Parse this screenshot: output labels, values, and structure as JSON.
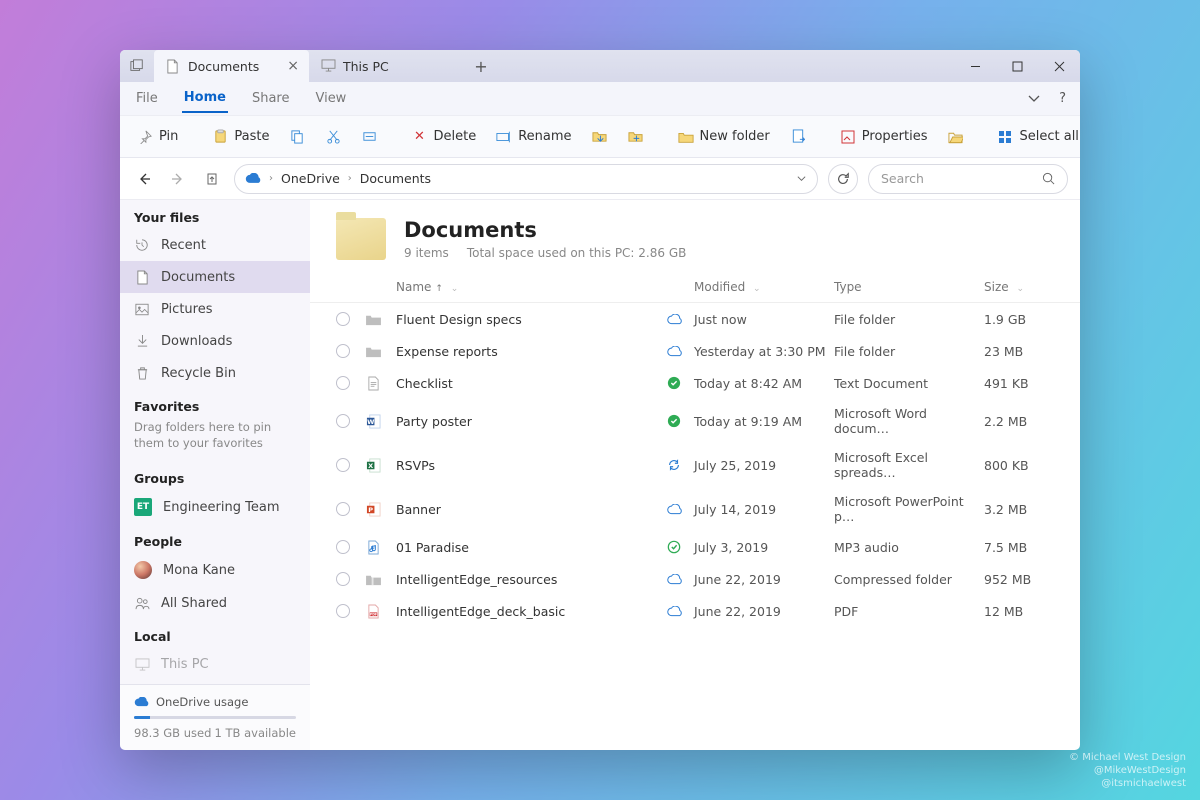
{
  "tabs": [
    {
      "label": "Documents",
      "icon": "document-icon",
      "active": true,
      "closable": true
    },
    {
      "label": "This PC",
      "icon": "pc-icon",
      "active": false,
      "closable": false
    }
  ],
  "menu": {
    "items": [
      "File",
      "Home",
      "Share",
      "View"
    ],
    "active": "Home"
  },
  "ribbon": {
    "pin": "Pin",
    "paste": "Paste",
    "delete": "Delete",
    "rename": "Rename",
    "newfolder": "New folder",
    "properties": "Properties",
    "selectall": "Select all"
  },
  "breadcrumb": [
    "OneDrive",
    "Documents"
  ],
  "search": {
    "placeholder": "Search"
  },
  "sidebar": {
    "sections": [
      {
        "title": "Your files",
        "items": [
          {
            "label": "Recent",
            "icon": "recent-icon"
          },
          {
            "label": "Documents",
            "icon": "document-icon",
            "selected": true
          },
          {
            "label": "Pictures",
            "icon": "pictures-icon"
          },
          {
            "label": "Downloads",
            "icon": "downloads-icon"
          },
          {
            "label": "Recycle Bin",
            "icon": "recycle-icon"
          }
        ]
      },
      {
        "title": "Favorites",
        "hint": "Drag folders here to pin them to your favorites"
      },
      {
        "title": "Groups",
        "items": [
          {
            "label": "Engineering Team",
            "icon": "et-chip",
            "chip": "ET"
          }
        ]
      },
      {
        "title": "People",
        "items": [
          {
            "label": "Mona Kane",
            "icon": "avatar"
          },
          {
            "label": "All Shared",
            "icon": "people-icon"
          }
        ]
      },
      {
        "title": "Local",
        "items": [
          {
            "label": "This PC",
            "icon": "pc-icon",
            "faded": true
          }
        ]
      }
    ],
    "storage": {
      "title": "OneDrive usage",
      "used": "98.3 GB used",
      "avail": "1 TB available"
    }
  },
  "header": {
    "title": "Documents",
    "count": "9 items",
    "space": "Total space used on this PC: 2.86 GB"
  },
  "columns": {
    "name": "Name",
    "modified": "Modified",
    "type": "Type",
    "size": "Size"
  },
  "files": [
    {
      "name": "Fluent Design specs",
      "icon": "folder-item",
      "status": "cloud",
      "modified": "Just now",
      "type": "File folder",
      "size": "1.9 GB"
    },
    {
      "name": "Expense reports",
      "icon": "folder-item",
      "status": "cloud",
      "modified": "Yesterday at 3:30 PM",
      "type": "File folder",
      "size": "23 MB"
    },
    {
      "name": "Checklist",
      "icon": "txt",
      "status": "synced",
      "modified": "Today at 8:42 AM",
      "type": "Text Document",
      "size": "491 KB"
    },
    {
      "name": "Party poster",
      "icon": "word",
      "status": "synced",
      "modified": "Today at 9:19 AM",
      "type": "Microsoft Word docum…",
      "size": "2.2 MB"
    },
    {
      "name": "RSVPs",
      "icon": "excel",
      "status": "syncing",
      "modified": "July 25, 2019",
      "type": "Microsoft Excel spreads…",
      "size": "800 KB"
    },
    {
      "name": "Banner",
      "icon": "ppt",
      "status": "cloud",
      "modified": "July 14, 2019",
      "type": "Microsoft PowerPoint p…",
      "size": "3.2 MB"
    },
    {
      "name": "01 Paradise",
      "icon": "audio",
      "status": "synced-ring",
      "modified": "July 3, 2019",
      "type": "MP3 audio",
      "size": "7.5 MB"
    },
    {
      "name": "IntelligentEdge_resources",
      "icon": "zip",
      "status": "cloud",
      "modified": "June 22, 2019",
      "type": "Compressed folder",
      "size": "952 MB"
    },
    {
      "name": "IntelligentEdge_deck_basic",
      "icon": "pdf",
      "status": "cloud",
      "modified": "June 22, 2019",
      "type": "PDF",
      "size": "12 MB"
    }
  ],
  "credits": {
    "l1": "© Michael West Design",
    "l2": "@MikeWestDesign",
    "l3": "@itsmichaelwest"
  }
}
